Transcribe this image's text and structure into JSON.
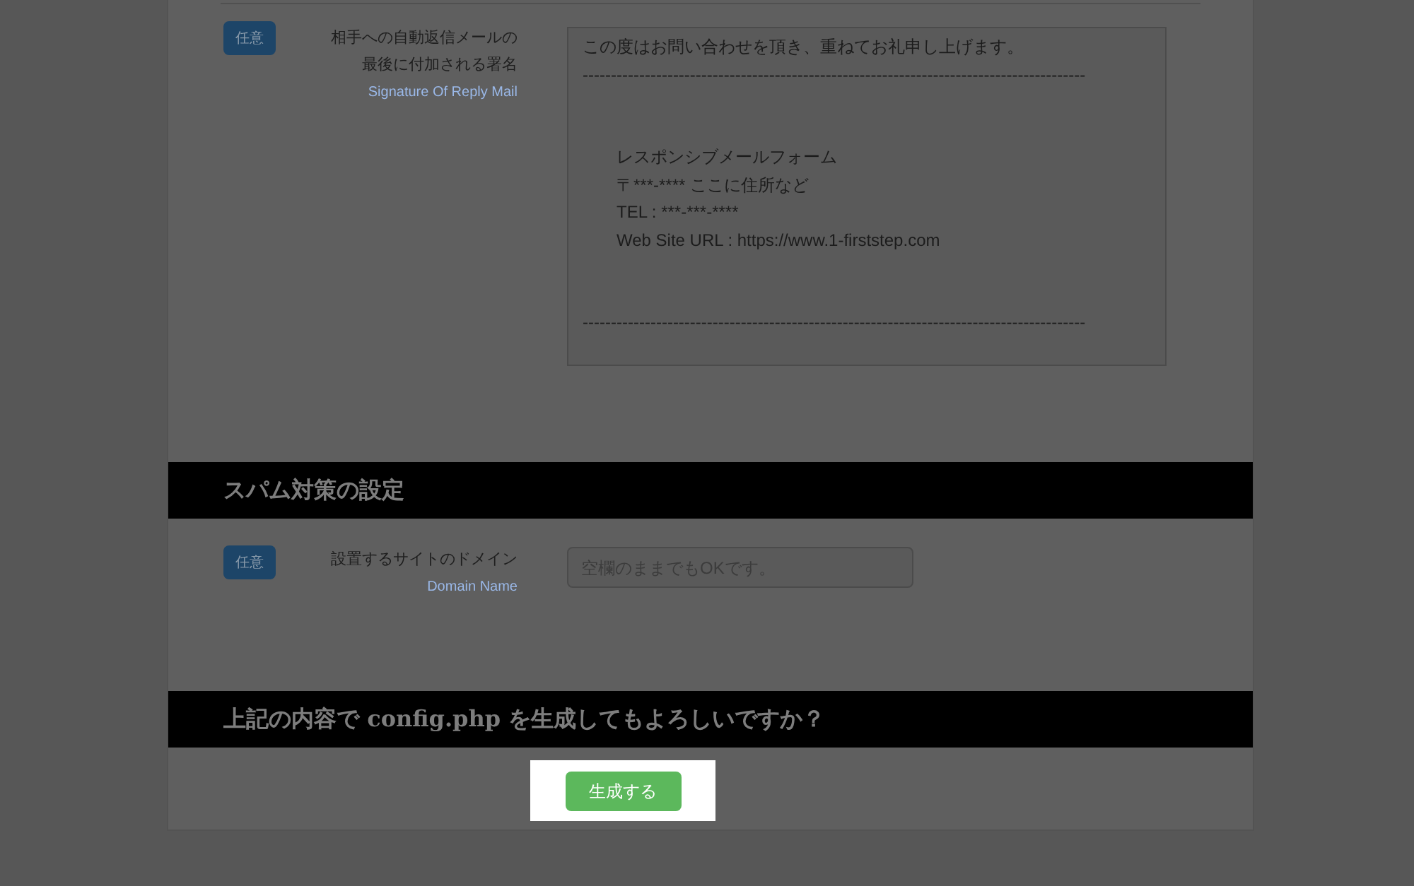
{
  "signature_row": {
    "badge": "任意",
    "label_lines": [
      "相手への自動返信メールの",
      "最後に付加される署名"
    ],
    "label_en": "Signature Of Reply Mail",
    "value_blocks": [
      {
        "indented": false,
        "lines": [
          "この度はお問い合わせを頂き、重ねてお礼申し上げます。",
          "-----------------------------------------------------------------------------------------"
        ]
      },
      {
        "indented": true,
        "lines": [
          "レスポンシブメールフォーム",
          "〒***-**** ここに住所など",
          "TEL : ***-***-****",
          "Web Site URL : https://www.1-firststep.com"
        ]
      },
      {
        "indented": false,
        "lines": [
          "-----------------------------------------------------------------------------------------"
        ]
      }
    ]
  },
  "spam_section": {
    "title": "スパム対策の設定",
    "badge": "任意",
    "label": "設置するサイトのドメイン",
    "label_en": "Domain Name",
    "placeholder": "空欄のままでもOKです。"
  },
  "confirm_section": {
    "title": "上記の内容で config.php を生成してもよろしいですか？",
    "button": "生成する"
  }
}
